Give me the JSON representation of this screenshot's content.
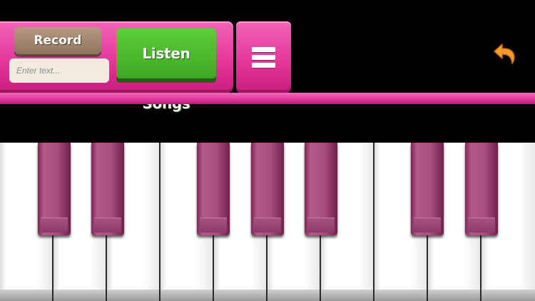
{
  "toolbar": {
    "record_label": "Record",
    "input_placeholder": "Enter text...",
    "input_value": "",
    "listen_songs_label": "Listen Songs",
    "menu_icon": "hamburger-menu-icon",
    "back_icon": "undo-arrow-icon"
  },
  "piano": {
    "white_keys_visible": 10,
    "black_keys_visible": 7
  },
  "colors": {
    "panel_pink": "#e4389c",
    "listen_green": "#4cb82c",
    "record_brown": "#a4876f",
    "back_orange": "#f29a2e",
    "black_key_mauve": "#a84e80"
  }
}
